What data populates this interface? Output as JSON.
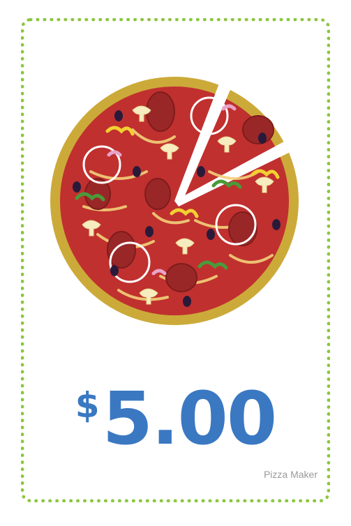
{
  "card": {
    "border_color": "#8cc63f"
  },
  "image": {
    "icon": "pizza-icon"
  },
  "price": {
    "currency": "$",
    "amount": "5.00",
    "color": "#3a78c2"
  },
  "brand": {
    "label": "Pizza Maker"
  }
}
